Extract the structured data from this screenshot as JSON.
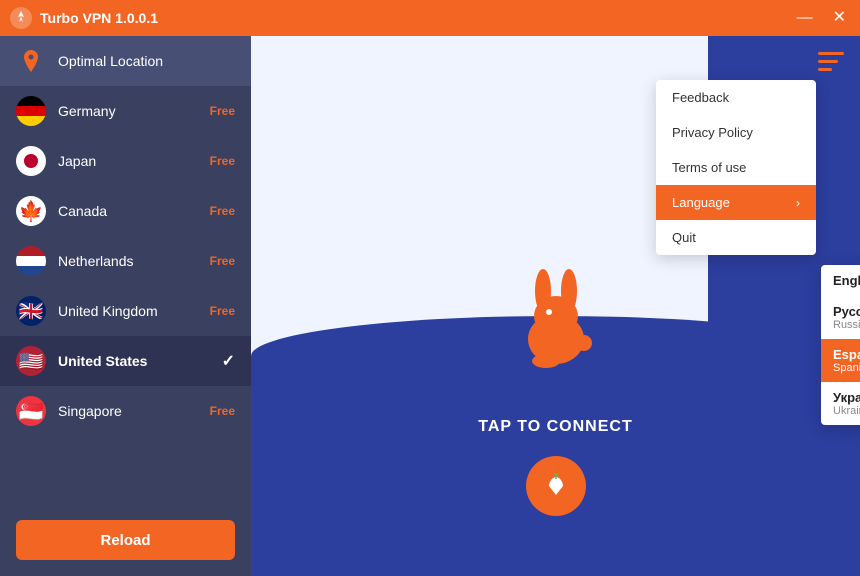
{
  "titleBar": {
    "title": "Turbo VPN  1.0.0.1",
    "minimizeLabel": "—",
    "closeLabel": "✕"
  },
  "sidebar": {
    "items": [
      {
        "id": "optimal",
        "name": "Optimal Location",
        "badge": "",
        "flag": "pin",
        "selected": false
      },
      {
        "id": "germany",
        "name": "Germany",
        "badge": "Free",
        "flag": "de",
        "selected": false
      },
      {
        "id": "japan",
        "name": "Japan",
        "badge": "Free",
        "flag": "jp",
        "selected": false
      },
      {
        "id": "canada",
        "name": "Canada",
        "badge": "Free",
        "flag": "ca",
        "selected": false
      },
      {
        "id": "netherlands",
        "name": "Netherlands",
        "badge": "Free",
        "flag": "nl",
        "selected": false
      },
      {
        "id": "uk",
        "name": "United Kingdom",
        "badge": "Free",
        "flag": "uk",
        "selected": false
      },
      {
        "id": "us",
        "name": "United States",
        "badge": "",
        "flag": "us",
        "selected": true
      },
      {
        "id": "singapore",
        "name": "Singapore",
        "badge": "Free",
        "flag": "sg",
        "selected": false
      }
    ],
    "reloadLabel": "Reload"
  },
  "mainPanel": {
    "menuIconTitle": "menu",
    "tapToConnect": "TAP TO CONNECT"
  },
  "dropdownMenu": {
    "items": [
      {
        "id": "feedback",
        "label": "Feedback",
        "active": false,
        "hasArrow": false
      },
      {
        "id": "privacy",
        "label": "Privacy Policy",
        "active": false,
        "hasArrow": false
      },
      {
        "id": "terms",
        "label": "Terms of use",
        "active": false,
        "hasArrow": false
      },
      {
        "id": "language",
        "label": "Language",
        "active": true,
        "hasArrow": true
      },
      {
        "id": "quit",
        "label": "Quit",
        "active": false,
        "hasArrow": false
      }
    ]
  },
  "languageSubmenu": {
    "items": [
      {
        "id": "english",
        "name": "English",
        "sub": "",
        "selected": true,
        "selectedStyle": "orange-dot"
      },
      {
        "id": "russian",
        "name": "Русский",
        "sub": "Russian",
        "selected": false,
        "selectedStyle": ""
      },
      {
        "id": "spanish",
        "name": "Español",
        "sub": "Spanish",
        "selected": true,
        "selectedStyle": "highlighted"
      },
      {
        "id": "ukraine",
        "name": "Українська",
        "sub": "Ukraine",
        "selected": false,
        "selectedStyle": ""
      }
    ]
  }
}
